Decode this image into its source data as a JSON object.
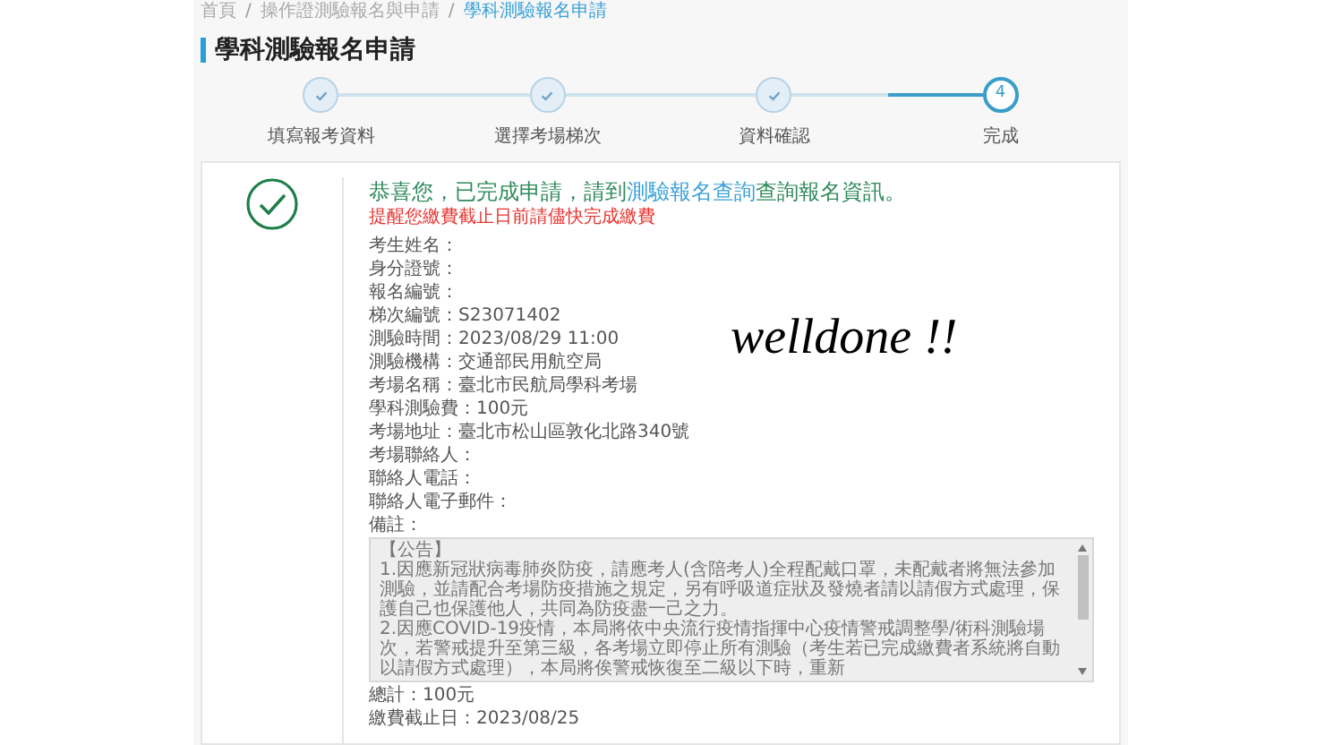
{
  "breadcrumb": [
    {
      "label": "首頁",
      "selected": false
    },
    {
      "separator": "/",
      "label": "操作證測驗報名與申請",
      "selected": false
    },
    {
      "separator": "/",
      "label": "學科測驗報名申請",
      "selected": true
    }
  ],
  "title": "學科測驗報名申請",
  "steps": [
    {
      "label": "填寫報考資料",
      "done": true
    },
    {
      "label": "選擇考場梯次",
      "done": true
    },
    {
      "label": "資料確認",
      "done": true
    },
    {
      "label": "完成",
      "done": false,
      "number": "4"
    }
  ],
  "result": {
    "message_before": "恭喜您，已完成申請，請到",
    "link": "測驗報名查詢",
    "message_after": "查詢報名資訊。",
    "warning": "提醒您繳費截止日前請儘快完成繳費",
    "fields": [
      {
        "label": "考生姓名："
      },
      {
        "label": "身分證號："
      },
      {
        "label": "報名編號："
      },
      {
        "label": "梯次編號：",
        "value": "S23071402"
      },
      {
        "label": "測驗時間：",
        "value": "2023/08/29 11:00"
      },
      {
        "label": "測驗機構：",
        "value": "交通部民用航空局"
      },
      {
        "label": "考場名稱：",
        "value": "臺北市民航局學科考場"
      },
      {
        "label": "學科測驗費：",
        "value": "100元"
      },
      {
        "label": "考場地址：",
        "value": "臺北市松山區敦化北路340號"
      },
      {
        "label": "考場聯絡人："
      },
      {
        "label": "聯絡人電話："
      },
      {
        "label": "聯絡人電子郵件："
      },
      {
        "label": "備註："
      }
    ],
    "notice": {
      "heading": "【公告】",
      "paragraphs": [
        "1.因應新冠狀病毒肺炎防疫，請應考人(含陪考人)全程配戴口罩，未配戴者將無法參加測驗，並請配合考場防疫措施之規定，另有呼吸道症狀及發燒者請以請假方式處理，保護自己也保護他人，共同為防疫盡一己之力。",
        "2.因應COVID-19疫情，本局將依中央流行疫情指揮中心疫情警戒調整學/術科測驗場次，若警戒提升至第三級，各考場立即停止所有測驗（考生若已完成繳費者系統將自動以請假方式處理），本局將俟警戒恢復至二級以下時，重新"
      ]
    },
    "total": {
      "label": "總計：",
      "value": "100元"
    },
    "deadline": {
      "label": "繳費截止日：",
      "value": "2023/08/25"
    }
  },
  "annotation": "welldone !!"
}
